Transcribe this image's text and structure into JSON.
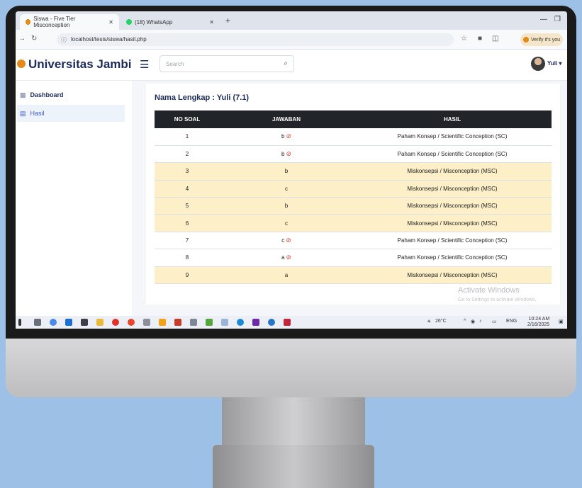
{
  "browser": {
    "tabs": [
      {
        "label": "Siswa - Five Tier Misconception",
        "close": "✕"
      },
      {
        "label": "(18) WhatsApp",
        "close": "✕"
      }
    ],
    "new_tab": "+",
    "url": "localhost/tesis/siswa/hasil.php",
    "verify_label": "Verify it's you"
  },
  "header": {
    "brand": "Universitas Jambi",
    "search_placeholder": "Search",
    "user": "Yuli ▾"
  },
  "sidebar": {
    "items": [
      {
        "label": "Dashboard"
      },
      {
        "label": "Hasil"
      }
    ]
  },
  "main": {
    "title": "Nama Lengkap : Yuli (7.1)",
    "columns": [
      "NO SOAL",
      "JAWABAN",
      "HASIL"
    ],
    "rows": [
      {
        "no": "1",
        "jawaban": "b",
        "correct": true,
        "hasil": "Paham Konsep / Scientific Conception (SC)"
      },
      {
        "no": "2",
        "jawaban": "b",
        "correct": true,
        "hasil": "Paham Konsep / Scientific Conception (SC)"
      },
      {
        "no": "3",
        "jawaban": "b",
        "correct": false,
        "hasil": "Miskonsepsi / Misconception (MSC)"
      },
      {
        "no": "4",
        "jawaban": "c",
        "correct": false,
        "hasil": "Miskonsepsi / Misconception (MSC)"
      },
      {
        "no": "5",
        "jawaban": "b",
        "correct": false,
        "hasil": "Miskonsepsi / Misconception (MSC)"
      },
      {
        "no": "6",
        "jawaban": "c",
        "correct": false,
        "hasil": "Miskonsepsi / Misconception (MSC)"
      },
      {
        "no": "7",
        "jawaban": "c",
        "correct": true,
        "hasil": "Paham Konsep / Scientific Conception (SC)"
      },
      {
        "no": "8",
        "jawaban": "a",
        "correct": true,
        "hasil": "Paham Konsep / Scientific Conception (SC)"
      },
      {
        "no": "9",
        "jawaban": "a",
        "correct": false,
        "hasil": "Miskonsepsi / Misconception (MSC)"
      }
    ]
  },
  "watermark": {
    "line1": "Activate Windows",
    "line2": "Go to Settings to activate Windows."
  },
  "taskbar": {
    "weather": "26°C",
    "lang": "ENG",
    "time": "10:24 AM",
    "date": "2/16/2025"
  },
  "colors": {
    "brand": "#1c2b59",
    "misconception_row": "#fdefc8",
    "table_header": "#212529",
    "check": "#d9453a"
  }
}
